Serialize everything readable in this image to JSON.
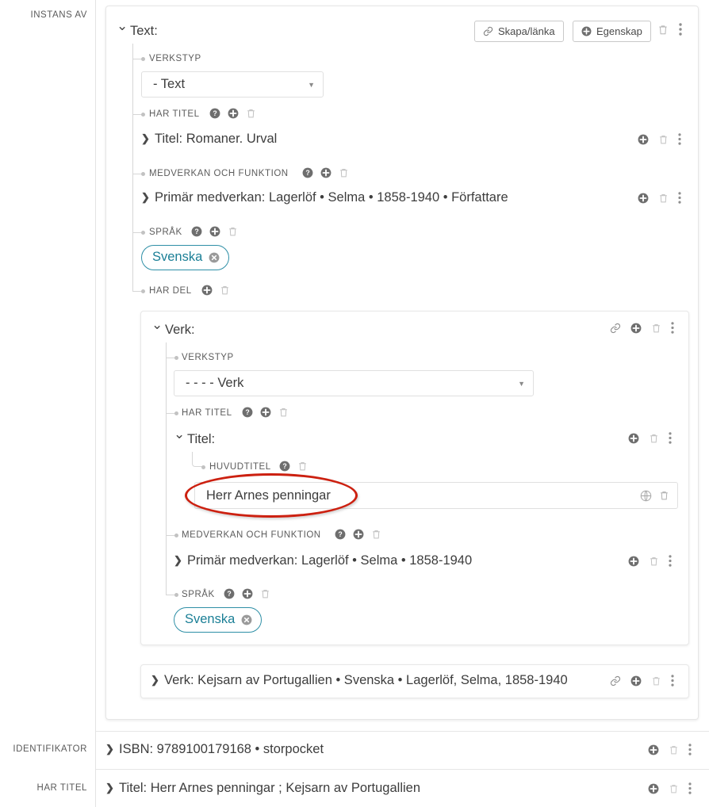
{
  "rail": {
    "instans_av": "INSTANS AV",
    "identifikator": "IDENTIFIKATOR",
    "har_titel": "HAR TITEL"
  },
  "outer_card": {
    "title": "Text:",
    "toolbar": {
      "skapa_lanka": "Skapa/länka",
      "egenskap": "Egenskap"
    },
    "properties": {
      "verkstyp_label": "VERKSTYP",
      "verkstyp_value": "- Text",
      "har_titel_label": "HAR TITEL",
      "titel_value": "Titel: Romaner. Urval",
      "medverkan_label": "MEDVERKAN OCH FUNKTION",
      "medverkan_value": "Primär medverkan: Lagerlöf • Selma • 1858-1940 • Författare",
      "sprak_label": "SPRÅK",
      "sprak_chip": "Svenska",
      "har_del_label": "HAR DEL"
    }
  },
  "inner_card": {
    "title": "Verk:",
    "properties": {
      "verkstyp_label": "VERKSTYP",
      "verkstyp_value": "- - - - Verk",
      "har_titel_label": "HAR TITEL",
      "titel_node": "Titel:",
      "huvudtitel_label": "HUVUDTITEL",
      "huvudtitel_value": "Herr Arnes penningar",
      "medverkan_label": "MEDVERKAN OCH FUNKTION",
      "medverkan_value": "Primär medverkan: Lagerlöf • Selma • 1858-1940",
      "sprak_label": "SPRÅK",
      "sprak_chip": "Svenska"
    }
  },
  "verk_row": {
    "value": "Verk: Kejsarn av Portugallien • Svenska • Lagerlöf, Selma, 1858-1940"
  },
  "bottom_rows": [
    {
      "value": "ISBN: 9789100179168 • storpocket"
    },
    {
      "value": "Titel: Herr Arnes penningar ; Kejsarn av Portugallien"
    }
  ],
  "colors": {
    "chip_border": "#2e8fa6",
    "chip_text": "#1b7f96",
    "annotation": "#cc2010",
    "icon": "#9a9a9a",
    "text": "#3d3d3d"
  },
  "icons": {
    "chevron_down": "chevron-down-icon",
    "chevron_right": "chevron-right-icon",
    "link": "link-icon",
    "plus_circle": "plus-circle-icon",
    "trash": "trash-icon",
    "kebab": "kebab-menu-icon",
    "help": "help-circle-icon",
    "globe": "globe-icon",
    "remove": "remove-circle-icon",
    "caret": "caret-down-icon"
  }
}
